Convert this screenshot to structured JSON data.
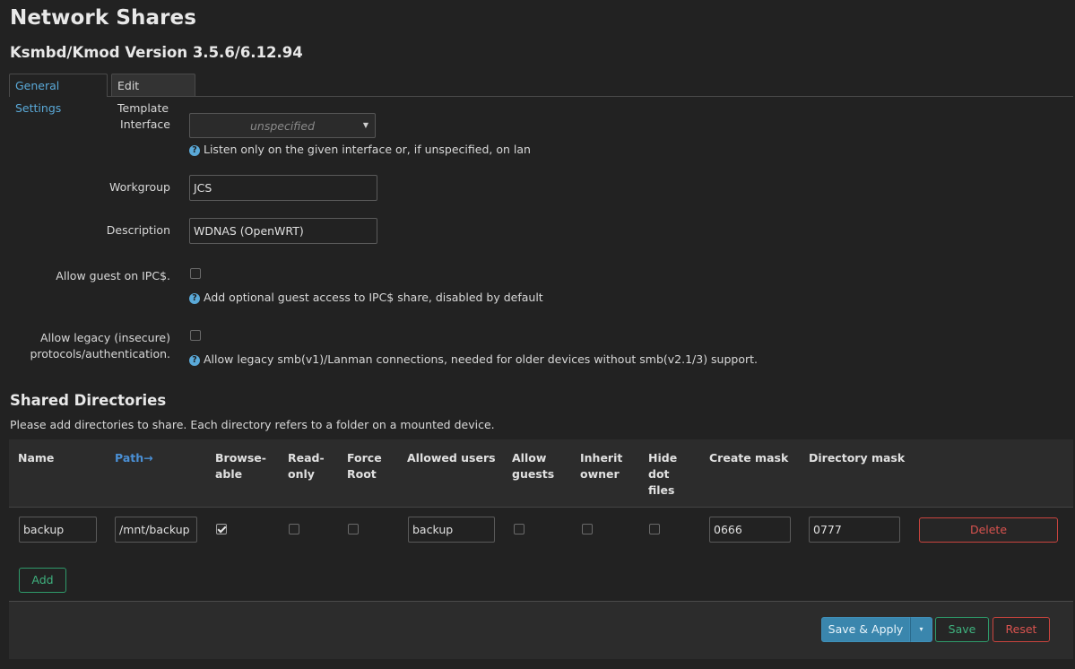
{
  "header": {
    "title": "Network Shares",
    "version": "Ksmbd/Kmod Version 3.5.6/6.12.94"
  },
  "tabs": [
    {
      "label": "General Settings",
      "active": true
    },
    {
      "label": "Edit Template",
      "active": false
    }
  ],
  "general": {
    "interface": {
      "label": "Interface",
      "value": "unspecified",
      "hint": "Listen only on the given interface or, if unspecified, on lan"
    },
    "workgroup": {
      "label": "Workgroup",
      "value": "JCS"
    },
    "description": {
      "label": "Description",
      "value": "WDNAS (OpenWRT)"
    },
    "allow_guest": {
      "label": "Allow guest on IPC$.",
      "checked": false,
      "hint": "Add optional guest access to IPC$ share, disabled by default"
    },
    "allow_legacy": {
      "label_line1": "Allow legacy (insecure)",
      "label_line2": "protocols/authentication.",
      "checked": false,
      "hint": "Allow legacy smb(v1)/Lanman connections, needed for older devices without smb(v2.1/3) support."
    }
  },
  "shares": {
    "title": "Shared Directories",
    "description": "Please add directories to share. Each directory refers to a folder on a mounted device.",
    "columns": {
      "name": "Name",
      "path": "Path",
      "path_sort_icon": "→",
      "browseable_1": "Browse-",
      "browseable_2": "able",
      "readonly_1": "Read-",
      "readonly_2": "only",
      "forceroot_1": "Force",
      "forceroot_2": "Root",
      "allowed_users": "Allowed users",
      "allowguests_1": "Allow",
      "allowguests_2": "guests",
      "inherit_1": "Inherit",
      "inherit_2": "owner",
      "hidedot_1": "Hide",
      "hidedot_2": "dot",
      "hidedot_3": "files",
      "create_mask": "Create mask",
      "directory_mask": "Directory mask"
    },
    "rows": [
      {
        "name": "backup",
        "path": "/mnt/backup",
        "browseable": true,
        "read_only": false,
        "force_root": false,
        "allowed_users": "backup",
        "allow_guests": false,
        "inherit_owner": false,
        "hide_dot_files": false,
        "create_mask": "0666",
        "directory_mask": "0777",
        "delete_label": "Delete"
      }
    ],
    "add_label": "Add"
  },
  "footer": {
    "save_apply_label": "Save & Apply",
    "dropdown_icon": "▾",
    "save_label": "Save",
    "reset_label": "Reset"
  },
  "colors": {
    "background": "#222222",
    "accent_blue": "#5aa9d8",
    "success_green": "#3fb27f",
    "danger_red": "#d9534f",
    "primary_button": "#3a86ad"
  }
}
